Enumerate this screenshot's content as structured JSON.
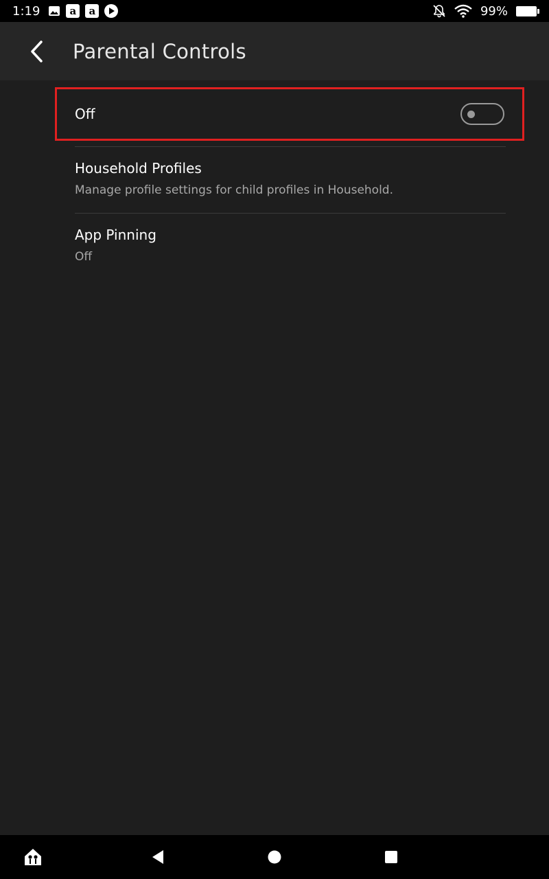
{
  "status_bar": {
    "time": "1:19",
    "battery": "99%",
    "icons": [
      "image-icon",
      "amazon-icon",
      "amazon-icon",
      "play-icon",
      "bell-off-icon",
      "wifi-icon",
      "battery-icon"
    ]
  },
  "header": {
    "title": "Parental Controls"
  },
  "toggle": {
    "label": "Off",
    "state": "off",
    "highlight_color": "#e02020"
  },
  "items": [
    {
      "title": "Household Profiles",
      "subtitle": "Manage profile settings for child profiles in Household."
    },
    {
      "title": "App Pinning",
      "subtitle": "Off"
    }
  ],
  "nav_bar": {
    "icons": [
      "kids-home-icon",
      "back-triangle-icon",
      "home-circle-icon",
      "recents-square-icon"
    ]
  }
}
